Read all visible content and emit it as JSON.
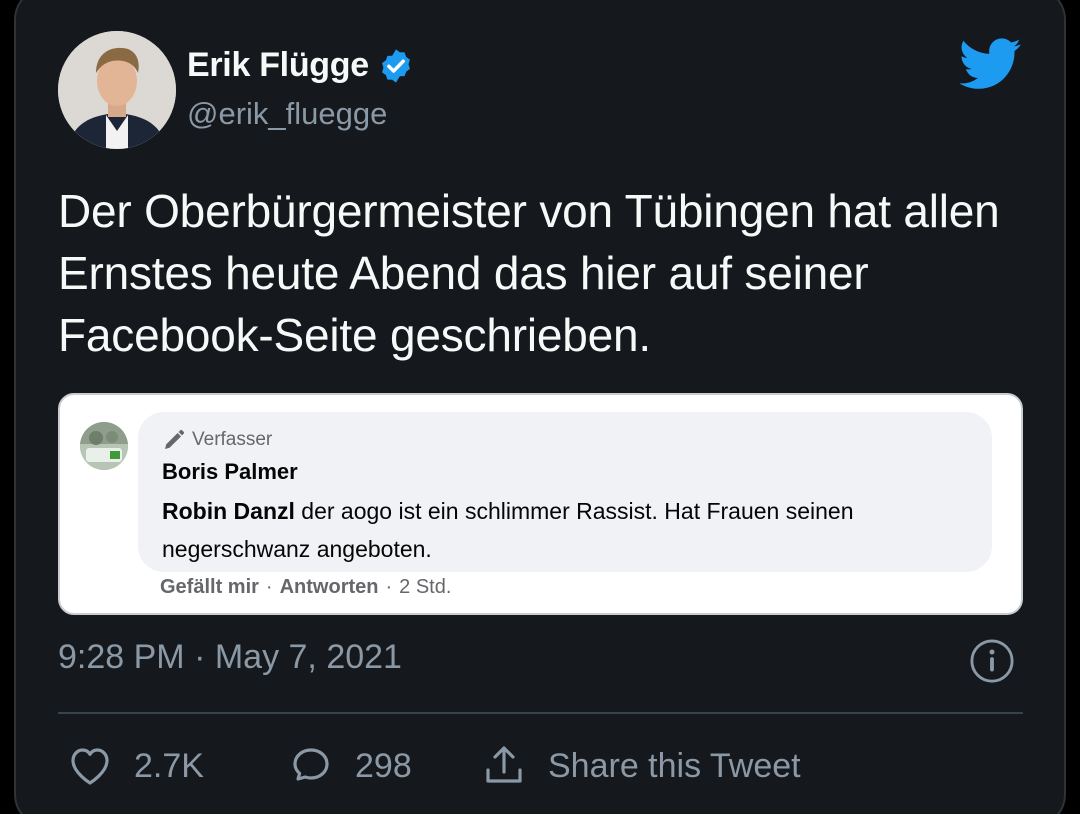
{
  "tweet": {
    "author_name": "Erik Flügge",
    "handle": "@erik_fluegge",
    "text": "Der Oberbürgermeister von Tübingen hat allen Ernstes heute Abend das hier auf seiner Facebook-Seite geschrieben.",
    "timestamp": "9:28 PM · May 7, 2021"
  },
  "embed": {
    "author_tag": "Verfasser",
    "commenter_name": "Boris Palmer",
    "mention": "Robin Danzl",
    "comment_text": " der aogo ist ein schlimmer Rassist. Hat Frauen seinen negerschwanz angeboten.",
    "like_action": "Gefällt mir",
    "reply_action": "Antworten",
    "time_ago": "2 Std.",
    "separator": "·"
  },
  "actions": {
    "likes": "2.7K",
    "replies": "298",
    "share_label": "Share this Tweet"
  },
  "icons": {
    "verified": "verified-badge-icon",
    "brand": "twitter-bird-icon",
    "info": "info-icon",
    "like": "heart-icon",
    "reply": "speech-bubble-icon",
    "share": "share-icon",
    "author_tag": "pencil-icon"
  },
  "colors": {
    "background": "#15181c",
    "accent": "#1d9bf0",
    "text": "#f7f9f9",
    "muted": "#8b98a5"
  }
}
